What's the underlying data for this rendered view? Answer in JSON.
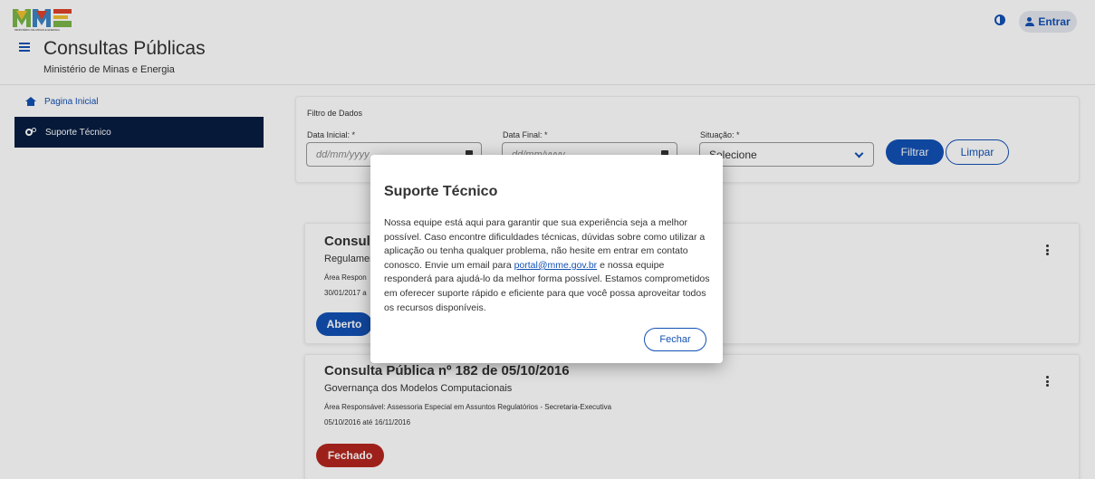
{
  "header": {
    "logo_text": "MME",
    "logo_subtext": "MINISTÉRIO DE MINAS E ENERGIA",
    "app_title": "Consultas Públicas",
    "app_subtitle": "Ministério de Minas e Energia",
    "login_label": "Entrar"
  },
  "sidebar": {
    "items": [
      {
        "label": "Pagina Inicial",
        "icon": "home-icon"
      },
      {
        "label": "Suporte Técnico",
        "icon": "cogs-icon"
      }
    ]
  },
  "filter": {
    "title": "Filtro de Dados",
    "start_label": "Data Inicial: *",
    "start_placeholder": "dd/mm/yyyy",
    "end_label": "Data Final: *",
    "end_placeholder": "dd/mm/yyyy",
    "status_label": "Situação: *",
    "status_value": "Selecione",
    "filter_button": "Filtrar",
    "clear_button": "Limpar"
  },
  "cards": [
    {
      "title": "Consulta",
      "subtitle": "Regulamen",
      "area": "Área Respon",
      "dates": "30/01/2017 a",
      "status": "Aberto",
      "status_color": "#1351b4"
    },
    {
      "title": "Consulta Pública nº 182 de 05/10/2016",
      "subtitle": "Governança dos Modelos Computacionais",
      "area": "Área Responsável: Assessoria Especial em Assuntos Regulatórios - Secretaria-Executiva",
      "dates": "05/10/2016 até 16/11/2016",
      "status": "Fechado",
      "status_color": "#b3261e"
    }
  ],
  "modal": {
    "title": "Suporte Técnico",
    "body_before": "Nossa equipe está aqui para garantir que sua experiência seja a melhor possível. Caso encontre dificuldades técnicas, dúvidas sobre como utilizar a aplicação ou tenha qualquer problema, não hesite em entrar em contato conosco. Envie um email para ",
    "email": "portal@mme.gov.br",
    "body_after": " e nossa equipe responderá para ajudá-lo da melhor forma possível. Estamos comprometidos em oferecer suporte rápido e eficiente para que você possa aproveitar todos os recursos disponíveis.",
    "close_button": "Fechar"
  },
  "colors": {
    "primary": "#1351b4",
    "sidebar_active": "#071d41",
    "closed": "#b3261e"
  }
}
